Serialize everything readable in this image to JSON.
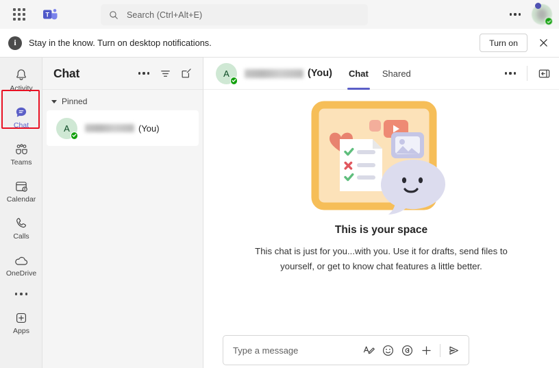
{
  "topbar": {
    "waffle_icon": "grid-apps-icon",
    "app_logo": "teams-logo-icon",
    "search": {
      "placeholder": "Search (Ctrl+Alt+E)",
      "value": "",
      "icon": "search-icon"
    },
    "more_icon": "more-horizontal-icon",
    "avatar": {
      "presence": "available",
      "presence_color": "#13A10E"
    }
  },
  "notification": {
    "icon": "info-icon",
    "message": "Stay in the know. Turn on desktop notifications.",
    "action_label": "Turn on",
    "close_icon": "close-icon"
  },
  "sidebar": {
    "items": [
      {
        "label": "Activity",
        "icon": "bell-icon",
        "active": false
      },
      {
        "label": "Chat",
        "icon": "chat-bubble-icon",
        "active": true
      },
      {
        "label": "Teams",
        "icon": "teams-people-icon",
        "active": false
      },
      {
        "label": "Calendar",
        "icon": "calendar-icon",
        "active": false
      },
      {
        "label": "Calls",
        "icon": "phone-icon",
        "active": false
      },
      {
        "label": "OneDrive",
        "icon": "cloud-icon",
        "active": false
      }
    ],
    "more_icon": "more-horizontal-icon",
    "apps": {
      "label": "Apps",
      "icon": "apps-plus-icon"
    },
    "highlight_color": "#E81123",
    "active_color": "#5B5FC7"
  },
  "chat_panel": {
    "title": "Chat",
    "more_icon": "more-horizontal-icon",
    "filter_icon": "filter-icon",
    "compose_icon": "new-chat-icon",
    "sections": [
      {
        "label": "Pinned",
        "expanded": true,
        "items": [
          {
            "avatar_initial": "A",
            "name_redacted": true,
            "suffix": "(You)",
            "presence": "available"
          }
        ]
      }
    ]
  },
  "main": {
    "header": {
      "avatar_initial": "A",
      "name_redacted": true,
      "you_label": "(You)",
      "tabs": [
        {
          "label": "Chat",
          "active": true
        },
        {
          "label": "Shared",
          "active": false
        }
      ],
      "more_icon": "more-horizontal-icon",
      "open_panel_icon": "open-side-panel-icon"
    },
    "empty_state": {
      "illustration": "your-space-illustration",
      "title": "This is your space",
      "description": "This chat is just for you...with you. Use it for drafts, send files to yourself, or get to know chat features a little better."
    },
    "compose": {
      "placeholder": "Type a message",
      "value": "",
      "format_icon": "format-text-icon",
      "emoji_icon": "emoji-icon",
      "giphy_icon": "giphy-icon",
      "plus_icon": "plus-icon",
      "send_icon": "send-icon"
    }
  },
  "colors": {
    "accent": "#5B5FC7",
    "presence_green": "#13A10E",
    "annotation_red": "#E81123",
    "illustration_frame": "#F6BE58",
    "illustration_fill": "#FCE2B9",
    "heart": "#E8836F",
    "bubble": "#DCDCEE"
  }
}
